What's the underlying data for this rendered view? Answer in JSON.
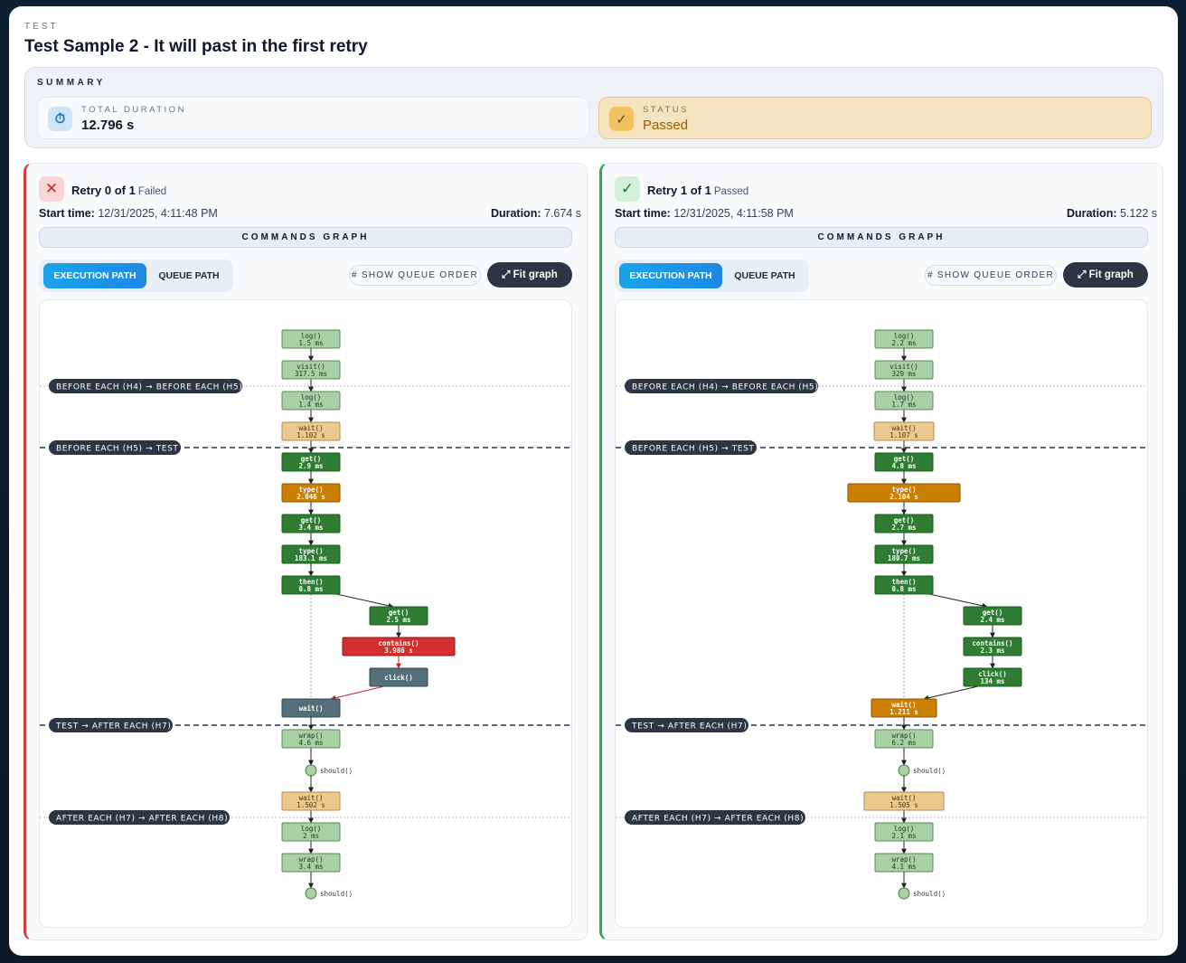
{
  "header": {
    "kicker": "TEST",
    "title": "Test Sample 2 - It will past in the first retry"
  },
  "summary": {
    "heading": "SUMMARY",
    "duration_label": "TOTAL DURATION",
    "duration_value": "12.796 s",
    "duration_icon": "stopwatch-icon",
    "status_label": "STATUS",
    "status_value": "Passed",
    "status_icon": "check-icon"
  },
  "colors": {
    "failed_accent": "#d63a3a",
    "passed_accent": "#2fa84f",
    "node_light": "#a9cfa4",
    "node_dark": "#2e7d32",
    "node_wait_light": "#ecc98f",
    "node_wait_dark": "#cc7f00",
    "node_error": "#d32f2f",
    "node_slate": "#546e7a"
  },
  "retries": [
    {
      "title": "Retry 0 of 1",
      "status": "Failed",
      "badge": "✕",
      "start_label": "Start time:",
      "start_value": "12/31/2025, 4:11:48 PM",
      "duration_label": "Duration:",
      "duration_value": "7.674 s",
      "graph_title": "COMMANDS GRAPH",
      "tab_execution": "EXECUTION PATH",
      "tab_queue": "QUEUE PATH",
      "show_queue": "# SHOW QUEUE ORDER",
      "fit_graph": "⤢ Fit graph",
      "phases": [
        {
          "label": "BEFORE EACH (H4) → BEFORE EACH (H5)",
          "style": "dotted"
        },
        {
          "label": "BEFORE EACH (H5) → TEST",
          "style": "dashed"
        },
        {
          "label": "TEST → AFTER EACH (H7)",
          "style": "dashed"
        },
        {
          "label": "AFTER EACH (H7) → AFTER EACH (H8)",
          "style": "dotted"
        }
      ],
      "nodes": [
        {
          "name": "log()",
          "time": "1.5 ms",
          "kind": "light"
        },
        {
          "name": "visit()",
          "time": "317.5 ms",
          "kind": "light"
        },
        {
          "name": "log()",
          "time": "1.4 ms",
          "kind": "light"
        },
        {
          "name": "wait()",
          "time": "1.102 s",
          "kind": "wait-light"
        },
        {
          "name": "get()",
          "time": "2.9 ms",
          "kind": "dark"
        },
        {
          "name": "type()",
          "time": "2.046 s",
          "kind": "wait-dark"
        },
        {
          "name": "get()",
          "time": "3.4 ms",
          "kind": "dark"
        },
        {
          "name": "type()",
          "time": "183.1 ms",
          "kind": "dark"
        },
        {
          "name": "then()",
          "time": "0.8 ms",
          "kind": "dark"
        },
        {
          "name": "get()",
          "time": "2.5 ms",
          "kind": "dark"
        },
        {
          "name": "contains()",
          "time": "3.986 s",
          "kind": "error"
        },
        {
          "name": "click()",
          "time": "",
          "kind": "slate"
        },
        {
          "name": "wait()",
          "time": "",
          "kind": "slate"
        },
        {
          "name": "wrap()",
          "time": "4.6 ms",
          "kind": "light"
        },
        {
          "name": "should()",
          "time": "",
          "kind": "circle"
        },
        {
          "name": "wait()",
          "time": "1.502 s",
          "kind": "wait-light"
        },
        {
          "name": "log()",
          "time": "2 ms",
          "kind": "light"
        },
        {
          "name": "wrap()",
          "time": "3.4 ms",
          "kind": "light"
        },
        {
          "name": "should()",
          "time": "",
          "kind": "circle"
        }
      ]
    },
    {
      "title": "Retry 1 of 1",
      "status": "Passed",
      "badge": "✓",
      "start_label": "Start time:",
      "start_value": "12/31/2025, 4:11:58 PM",
      "duration_label": "Duration:",
      "duration_value": "5.122 s",
      "graph_title": "COMMANDS GRAPH",
      "tab_execution": "EXECUTION PATH",
      "tab_queue": "QUEUE PATH",
      "show_queue": "# SHOW QUEUE ORDER",
      "fit_graph": "⤢ Fit graph",
      "phases": [
        {
          "label": "BEFORE EACH (H4) → BEFORE EACH (H5)",
          "style": "dotted"
        },
        {
          "label": "BEFORE EACH (H5) → TEST",
          "style": "dashed"
        },
        {
          "label": "TEST → AFTER EACH (H7)",
          "style": "dashed"
        },
        {
          "label": "AFTER EACH (H7) → AFTER EACH (H8)",
          "style": "dotted"
        }
      ],
      "nodes": [
        {
          "name": "log()",
          "time": "2.2 ms",
          "kind": "light"
        },
        {
          "name": "visit()",
          "time": "329 ms",
          "kind": "light"
        },
        {
          "name": "log()",
          "time": "1.7 ms",
          "kind": "light"
        },
        {
          "name": "wait()",
          "time": "1.107 s",
          "kind": "wait-light"
        },
        {
          "name": "get()",
          "time": "4.8 ms",
          "kind": "dark"
        },
        {
          "name": "type()",
          "time": "2.104 s",
          "kind": "wait-dark"
        },
        {
          "name": "get()",
          "time": "2.7 ms",
          "kind": "dark"
        },
        {
          "name": "type()",
          "time": "180.7 ms",
          "kind": "dark"
        },
        {
          "name": "then()",
          "time": "0.8 ms",
          "kind": "dark"
        },
        {
          "name": "get()",
          "time": "2.4 ms",
          "kind": "dark"
        },
        {
          "name": "contains()",
          "time": "2.3 ms",
          "kind": "dark"
        },
        {
          "name": "click()",
          "time": "134 ms",
          "kind": "dark"
        },
        {
          "name": "wait()",
          "time": "1.211 s",
          "kind": "wait-dark"
        },
        {
          "name": "wrap()",
          "time": "6.2 ms",
          "kind": "light"
        },
        {
          "name": "should()",
          "time": "",
          "kind": "circle"
        },
        {
          "name": "wait()",
          "time": "1.505 s",
          "kind": "wait-light"
        },
        {
          "name": "log()",
          "time": "2.1 ms",
          "kind": "light"
        },
        {
          "name": "wrap()",
          "time": "4.1 ms",
          "kind": "light"
        },
        {
          "name": "should()",
          "time": "",
          "kind": "circle"
        }
      ]
    }
  ]
}
